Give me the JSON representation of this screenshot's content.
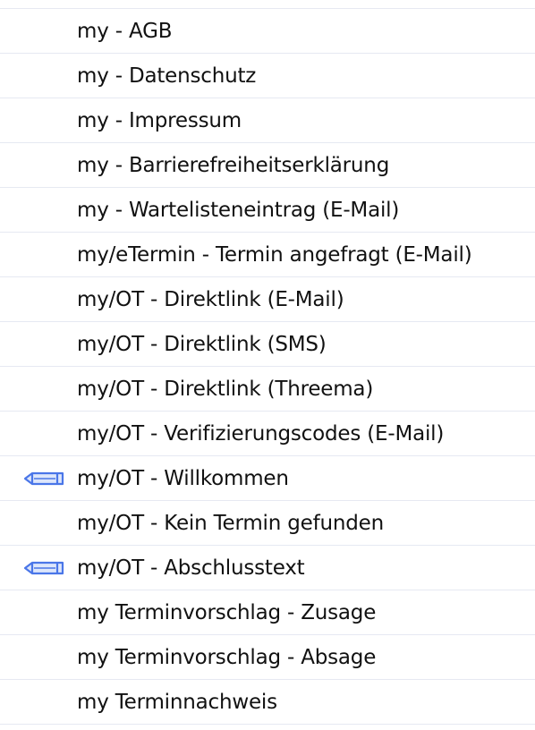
{
  "templates": {
    "items": [
      {
        "label": "",
        "has_edit_icon": false,
        "icon": "pencil-icon"
      },
      {
        "label": "my - AGB",
        "has_edit_icon": false,
        "icon": "pencil-icon"
      },
      {
        "label": "my - Datenschutz",
        "has_edit_icon": false,
        "icon": "pencil-icon"
      },
      {
        "label": "my - Impressum",
        "has_edit_icon": false,
        "icon": "pencil-icon"
      },
      {
        "label": "my - Barrierefreiheitserklärung",
        "has_edit_icon": false,
        "icon": "pencil-icon"
      },
      {
        "label": "my - Wartelisteneintrag (E-Mail)",
        "has_edit_icon": false,
        "icon": "pencil-icon"
      },
      {
        "label": "my/eTermin - Termin angefragt (E-Mail)",
        "has_edit_icon": false,
        "icon": "pencil-icon"
      },
      {
        "label": "my/OT - Direktlink (E-Mail)",
        "has_edit_icon": false,
        "icon": "pencil-icon"
      },
      {
        "label": "my/OT - Direktlink (SMS)",
        "has_edit_icon": false,
        "icon": "pencil-icon"
      },
      {
        "label": "my/OT - Direktlink (Threema)",
        "has_edit_icon": false,
        "icon": "pencil-icon"
      },
      {
        "label": "my/OT - Verifizierungscodes (E-Mail)",
        "has_edit_icon": false,
        "icon": "pencil-icon"
      },
      {
        "label": "my/OT - Willkommen",
        "has_edit_icon": true,
        "icon": "pencil-icon"
      },
      {
        "label": "my/OT - Kein Termin gefunden",
        "has_edit_icon": false,
        "icon": "pencil-icon"
      },
      {
        "label": "my/OT - Abschlusstext",
        "has_edit_icon": true,
        "icon": "pencil-icon"
      },
      {
        "label": "my Terminvorschlag - Zusage",
        "has_edit_icon": false,
        "icon": "pencil-icon"
      },
      {
        "label": "my Terminvorschlag - Absage",
        "has_edit_icon": false,
        "icon": "pencil-icon"
      },
      {
        "label": "my Terminnachweis",
        "has_edit_icon": false,
        "icon": "pencil-icon"
      }
    ]
  },
  "colors": {
    "icon_accent": "#4a76e8",
    "icon_fill": "#dde6fb",
    "divider": "#e6e9f2",
    "text": "#111111"
  }
}
